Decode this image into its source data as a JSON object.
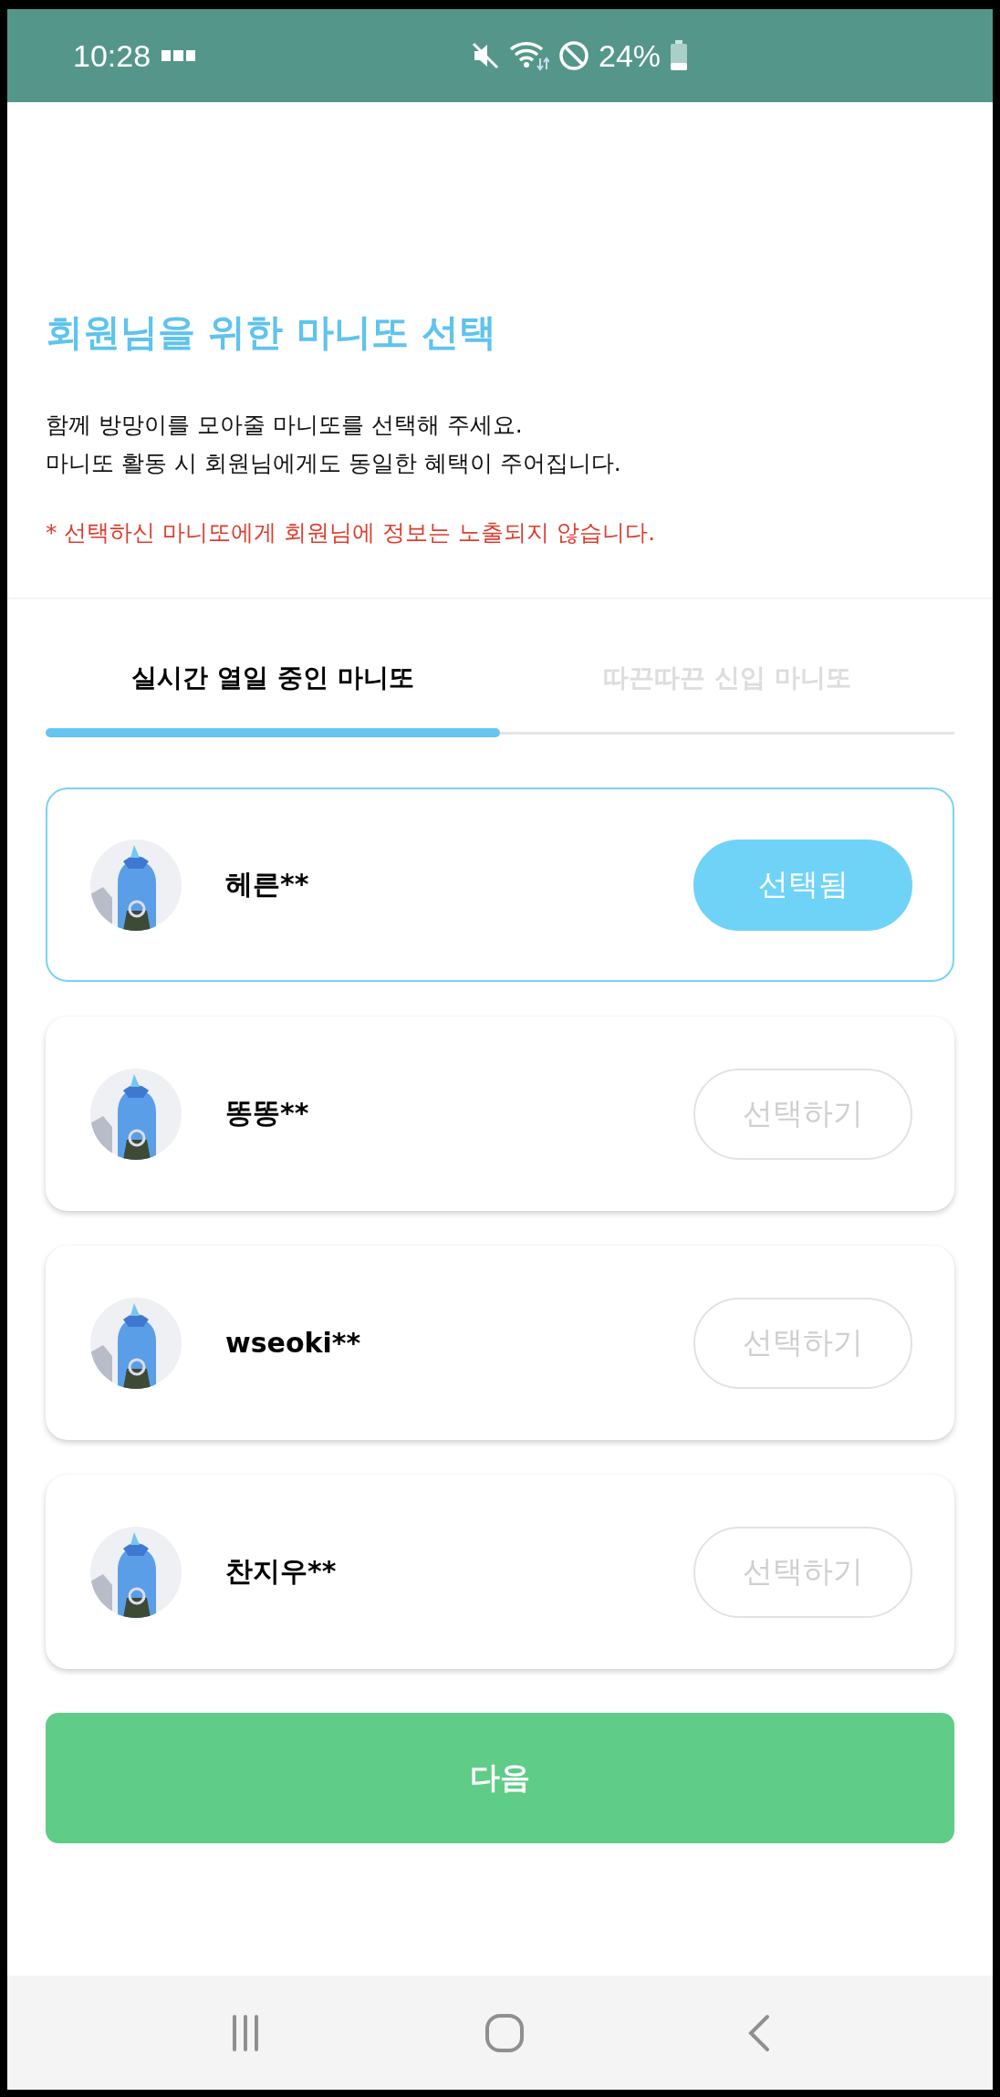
{
  "status_bar": {
    "time": "10:28",
    "battery": "24%"
  },
  "title": "회원님을 위한 마니또 선택",
  "intro": [
    "함께 방망이를 모아줄 마니또를 선택해 주세요.",
    "마니또 활동 시 회원님에게도 동일한 혜택이 주어집니다."
  ],
  "notice": "* 선택하신 마니또에게 회원님에 정보는 노출되지 않습니다.",
  "tabs": [
    {
      "label": "실시간 열일 중인 마니또",
      "selected": true
    },
    {
      "label": "따끈따끈 신입 마니또",
      "selected": false
    }
  ],
  "manitos": [
    {
      "name": "헤른**",
      "selected": true,
      "button": "선택됨"
    },
    {
      "name": "똥똥**",
      "selected": false,
      "button": "선택하기"
    },
    {
      "name": "wseoki**",
      "selected": false,
      "button": "선택하기"
    },
    {
      "name": "찬지우**",
      "selected": false,
      "button": "선택하기"
    }
  ],
  "next_button": "다음"
}
